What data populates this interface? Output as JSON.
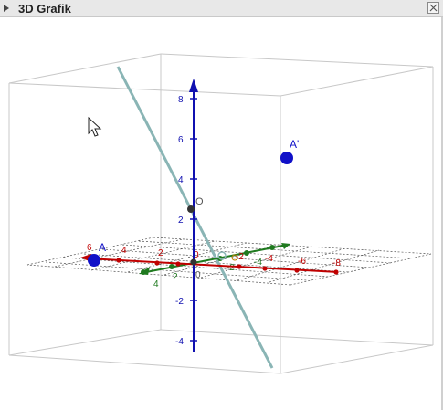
{
  "view": {
    "title": "3D Grafik"
  },
  "icons": {
    "collapse": "collapse-triangle-icon",
    "close": "close-x-icon",
    "cursor": "mouse-cursor-icon"
  },
  "colors": {
    "x_axis": "#c00000",
    "y_axis": "#1f7a1f",
    "z_axis": "#1010b0",
    "line": "#8ab5b5",
    "point": "#1010c8"
  },
  "axes": {
    "z_ticks": [
      "8",
      "6",
      "4",
      "2",
      "-2",
      "-4"
    ],
    "x_ticks": [
      "6",
      "4",
      "2",
      "0",
      "-2",
      "-4",
      "-6",
      "-8"
    ],
    "y_ticks": [
      "4",
      "2",
      "-2",
      "-4"
    ]
  },
  "points": {
    "A": "A",
    "A_prime": "A'",
    "O": "O",
    "origin": "0"
  }
}
